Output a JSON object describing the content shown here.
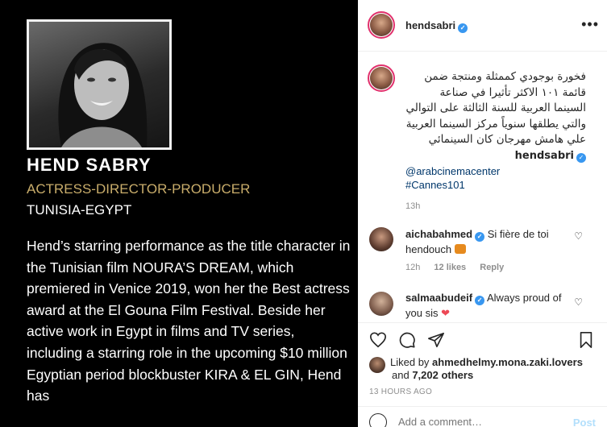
{
  "post_image": {
    "name": "HEND SABRY",
    "role": "ACTRESS-DIRECTOR-PRODUCER",
    "country": "TUNISIA-EGYPT",
    "bio": "Hend’s starring performance as the title character in the Tunisian film NOURA’S DREAM, which premiered in Venice 2019, won her the Best actress award at the El Gouna Film Festival. Beside her active work in Egypt in films and TV series, including a starring role in the upcoming $10 million Egyptian period blockbuster KIRA & EL GIN, Hend has"
  },
  "header": {
    "username": "hendsabri",
    "more_icon": "ellipsis-icon"
  },
  "caption": {
    "username": "hendsabri",
    "text": "فخورة بوجودي كممثلة ومنتجة ضمن قائمة ١٠١ الاكثر تأثيرا في صناعة السينما العربية للسنة الثالثة على التوالي والتي يطلقها سنوياً مركز السينما العربية علي هامش مهرجان كان السينمائي",
    "mention": "@arabcinemacenter",
    "hashtag": "#Cannes101",
    "time": "13h"
  },
  "comments": [
    {
      "username": "aichabahmed",
      "text": "Si fière de toi hendouch",
      "time": "12h",
      "likes": "12 likes",
      "reply": "Reply"
    },
    {
      "username": "salmaabudeif",
      "text": "Always proud of you sis",
      "heart_emoji": "❤"
    }
  ],
  "actions": {
    "like_icon": "heart-icon",
    "comment_icon": "comment-icon",
    "share_icon": "share-icon",
    "save_icon": "bookmark-icon"
  },
  "likes": {
    "liked_by_prefix": "Liked by",
    "liked_by_user": "ahmedhelmy.mona.zaki.lovers",
    "and_text": "and",
    "others": "7,202 others"
  },
  "post_time": "13 HOURS AGO",
  "add_comment": {
    "placeholder": "Add a comment…",
    "post_label": "Post"
  },
  "colors": {
    "accent_gold": "#c9ad6b",
    "link_blue": "#00376b",
    "verified_blue": "#3897f0",
    "story_ring": "#e1306c",
    "heart_red": "#ed4956"
  }
}
